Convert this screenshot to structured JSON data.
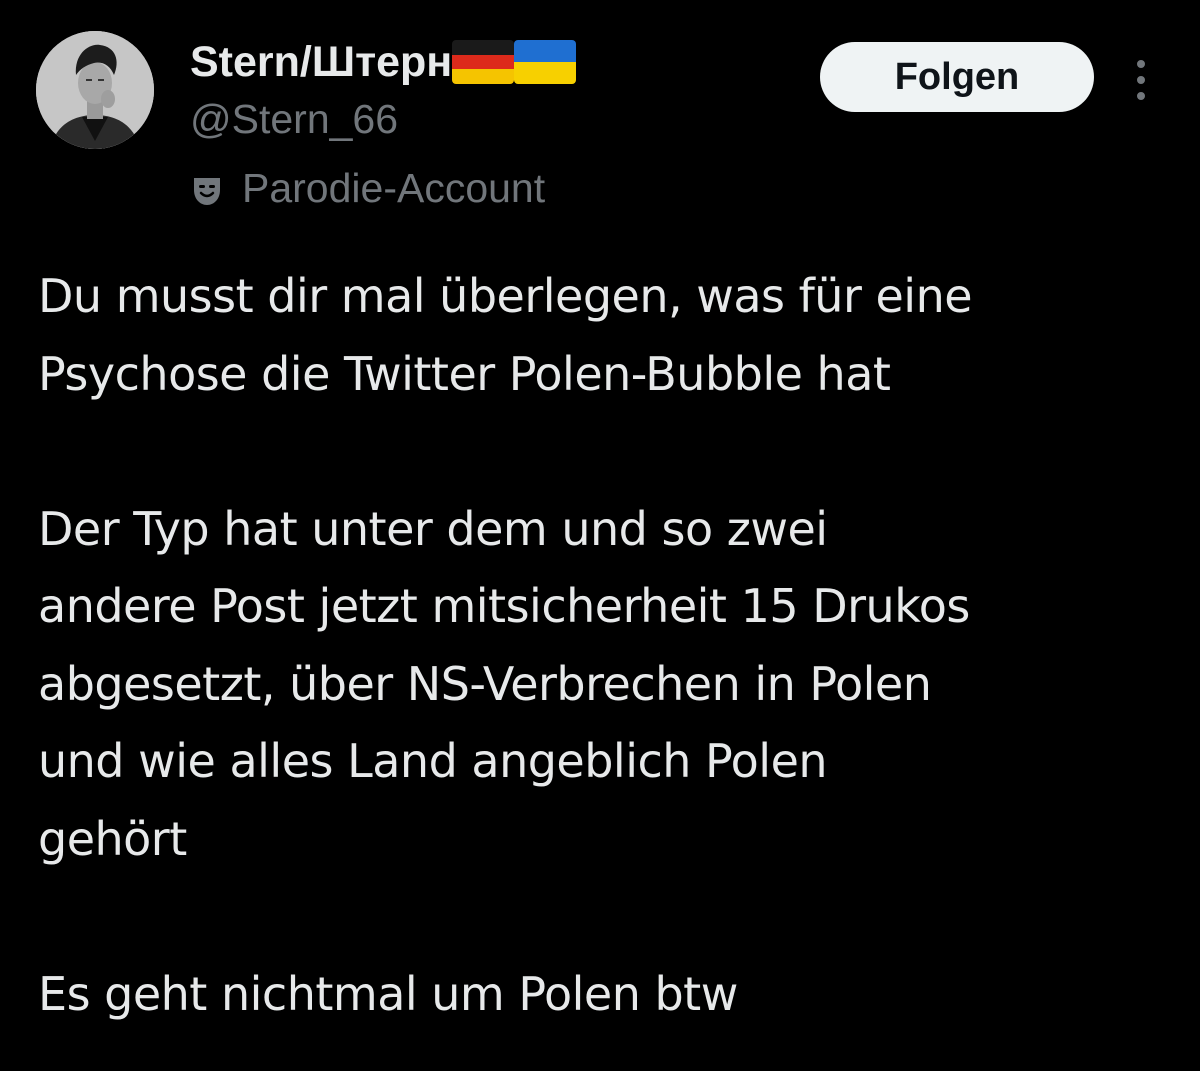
{
  "author": {
    "display_name": "Stern/Штерн",
    "flags": [
      "germany-flag",
      "ukraine-flag"
    ],
    "handle": "@Stern_66",
    "label_icon": "theater-mask-icon",
    "label": "Parodie-Account"
  },
  "actions": {
    "follow_label": "Folgen",
    "more_icon": "more-vertical-icon"
  },
  "tweet": {
    "paragraphs": [
      "Du musst dir mal überlegen, was für eine\nPsychose die Twitter Polen-Bubble hat",
      "Der Typ hat unter dem und so zwei\nandere Post jetzt mitsicherheit 15 Drukos\nabgesetzt, über NS-Verbrechen in Polen\nund wie alles Land angeblich Polen\ngehört",
      "Es geht nichtmal um Polen btw"
    ]
  },
  "colors": {
    "background": "#000000",
    "text_primary": "#e7e9ea",
    "text_secondary": "#71767b",
    "button_bg": "#eff3f4",
    "button_text": "#0f1419"
  }
}
